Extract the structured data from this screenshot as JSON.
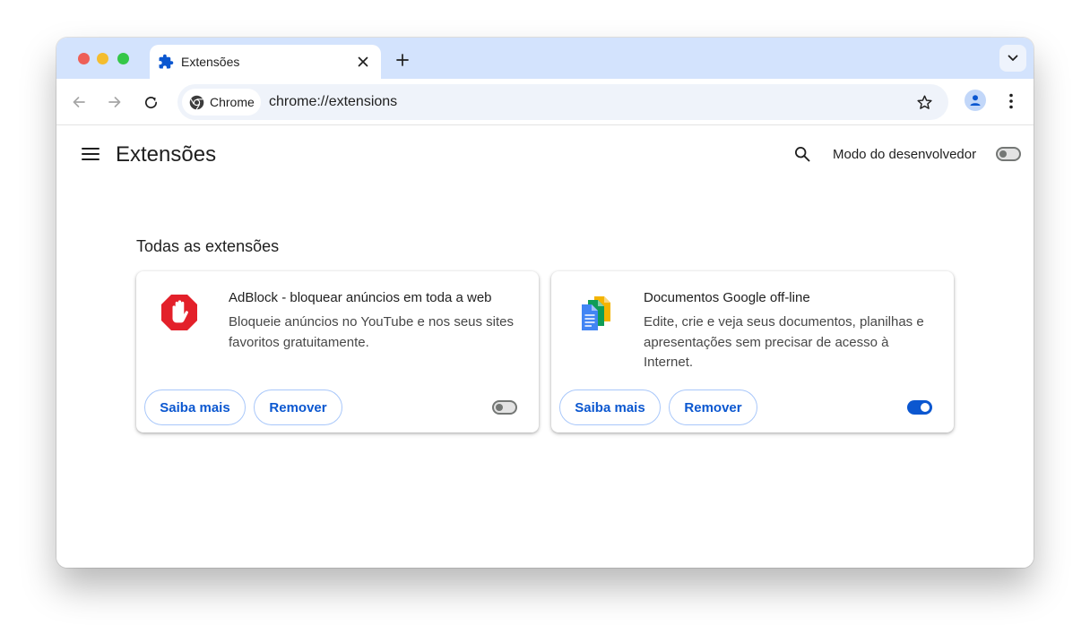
{
  "tab": {
    "title": "Extensões"
  },
  "omnibox": {
    "chip_label": "Chrome",
    "url": "chrome://extensions"
  },
  "page": {
    "title": "Extensões",
    "dev_mode_label": "Modo do desenvolvedor",
    "dev_mode_enabled": false,
    "section_title": "Todas as extensões"
  },
  "extensions": [
    {
      "name": "AdBlock - bloquear anúncios em toda a web",
      "description": "Bloqueie anúncios no YouTube e nos seus sites favoritos gratuitamente.",
      "learn_more": "Saiba mais",
      "remove": "Remover",
      "enabled": false,
      "icon": "adblock-stop-hand-icon"
    },
    {
      "name": "Documentos Google off-line",
      "description": "Edite, crie e veja seus documentos, planilhas e apresentações sem precisar de acesso à Internet.",
      "learn_more": "Saiba mais",
      "remove": "Remover",
      "enabled": true,
      "icon": "google-docs-offline-icon"
    }
  ],
  "colors": {
    "tabstrip": "#d3e3fd",
    "accent": "#0b57d0",
    "adblock_red": "#e3202a",
    "docs_blue": "#4285f4",
    "sheets_green": "#0f9d58",
    "slides_yellow": "#f4b400"
  }
}
